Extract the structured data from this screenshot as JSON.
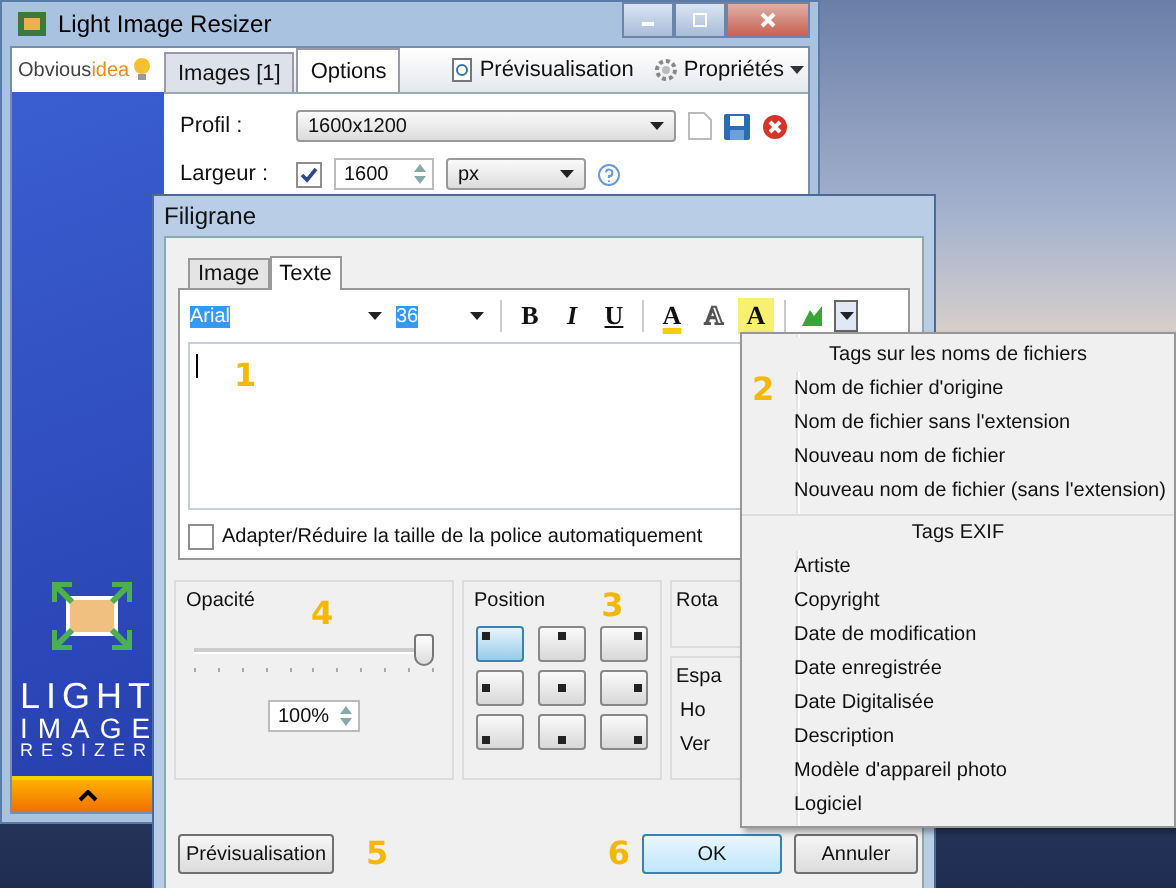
{
  "main_window": {
    "title": "Light Image Resizer",
    "logo": {
      "part_1": "Obvious",
      "part_2": "idea"
    },
    "tabs": [
      {
        "label": "Images [1]",
        "selected": false
      },
      {
        "label": "Options",
        "selected": true
      }
    ],
    "toolbar": [
      {
        "label": "Prévisualisation",
        "kind": "preview"
      },
      {
        "label": "Propriétés",
        "kind": "settings"
      }
    ],
    "profile": {
      "label": "Profil :",
      "value": "1600x1200"
    },
    "width": {
      "label": "Largeur :",
      "checked": true,
      "value": "1600",
      "unit": "px"
    },
    "sidebar": {
      "brand_lines": [
        "LIGHT",
        "IMAGE",
        "RESIZER"
      ]
    }
  },
  "dialog": {
    "title": "Filigrane",
    "tabs": [
      {
        "label": "Image",
        "selected": false
      },
      {
        "label": "Texte",
        "selected": true
      }
    ],
    "font": {
      "value": "Arial",
      "highlighted": true
    },
    "size": {
      "value": "36",
      "highlighted": true
    },
    "format_buttons": [
      {
        "label": "B",
        "kind": "bold"
      },
      {
        "label": "I",
        "kind": "italic"
      },
      {
        "label": "U",
        "kind": "underline"
      },
      {
        "label": "A",
        "kind": "color"
      },
      {
        "label": "A",
        "kind": "outline"
      },
      {
        "label": "A",
        "kind": "highlight"
      }
    ],
    "tag_button": {
      "pressed": true
    },
    "text_area": {
      "annotation": "1"
    },
    "autofit": {
      "label": "Adapter/Réduire la taille de la police automatiquement",
      "checked": false
    },
    "opacity": {
      "title": "Opacité",
      "annotation": "4",
      "level": 1,
      "reading": "100%"
    },
    "position": {
      "title": "Position",
      "annotation": "3",
      "cells": [
        {
          "selected": true
        },
        {
          "selected": false
        },
        {
          "selected": false
        },
        {
          "selected": false
        },
        {
          "selected": false
        },
        {
          "selected": false
        },
        {
          "selected": false
        },
        {
          "selected": false
        },
        {
          "selected": false
        }
      ]
    },
    "rotation": {
      "title": "Rota"
    },
    "spacing": {
      "title": "Espa",
      "rows": [
        "Ho",
        "Ver"
      ]
    },
    "preview_button": {
      "label": "Prévisualisation",
      "annotation": "5"
    },
    "ok_button": {
      "label": "OK",
      "annotation": "6"
    },
    "cancel_button": {
      "label": "Annuler"
    }
  },
  "menu": {
    "annotation": "2",
    "sections": [
      {
        "header": "Tags sur les noms de fichiers",
        "items": [
          "Nom de fichier d'origine",
          "Nom de fichier sans l'extension",
          "Nouveau nom de fichier",
          "Nouveau nom de fichier (sans l'extension)"
        ]
      },
      {
        "header": "Tags EXIF",
        "items": [
          "Artiste",
          "Copyright",
          "Date de modification",
          "Date enregistrée",
          "Date Digitalisée",
          "Description",
          "Modèle d'appareil photo",
          "Logiciel"
        ]
      }
    ]
  }
}
